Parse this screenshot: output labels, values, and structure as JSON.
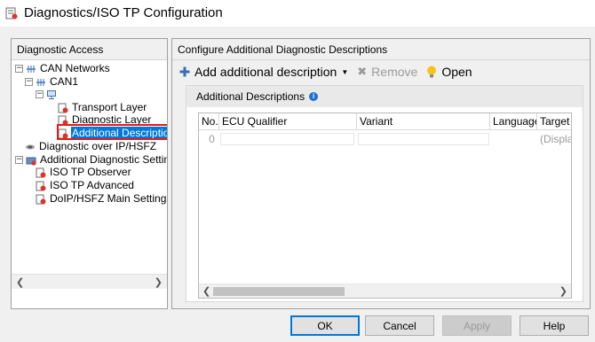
{
  "window": {
    "title": "Diagnostics/ISO TP Configuration"
  },
  "left_panel": {
    "header": "Diagnostic Access",
    "tree": [
      {
        "label": "CAN Networks",
        "icon": "network-icon",
        "expanded": true
      },
      {
        "label": "CAN1",
        "icon": "network-icon",
        "expanded": true
      },
      {
        "label": "",
        "icon": "computer-node-icon",
        "expanded": true
      },
      {
        "label": "Transport Layer",
        "icon": "settings-doc-icon"
      },
      {
        "label": "Diagnostic Layer",
        "icon": "settings-doc-icon"
      },
      {
        "label": "Additional Descriptions",
        "icon": "settings-doc-icon",
        "selected": true
      },
      {
        "label": "Diagnostic over IP/HSFZ",
        "icon": "ethernet-icon"
      },
      {
        "label": "Additional Diagnostic Settings",
        "icon": "settings-folder-icon",
        "expanded": true
      },
      {
        "label": "ISO TP Observer",
        "icon": "settings-doc-icon"
      },
      {
        "label": "ISO TP Advanced",
        "icon": "settings-doc-icon"
      },
      {
        "label": "DoIP/HSFZ Main Settings",
        "icon": "settings-doc-icon"
      }
    ]
  },
  "right_panel": {
    "header": "Configure Additional Diagnostic Descriptions",
    "toolbar": {
      "add_label": "Add additional description",
      "remove_label": "Remove",
      "open_label": "Open"
    },
    "section_title": "Additional Descriptions",
    "table": {
      "columns": [
        "No.",
        "ECU Qualifier",
        "Variant",
        "Language",
        "Target"
      ],
      "rows": [
        {
          "no": "0",
          "ecu_qualifier": "",
          "variant": "",
          "language": "",
          "target": "(Displa"
        }
      ]
    }
  },
  "buttons": {
    "ok": "OK",
    "cancel": "Cancel",
    "apply": "Apply",
    "help": "Help"
  },
  "colors": {
    "selection": "#0078d7",
    "highlight_box": "#e21a1a",
    "accent_blue": "#1f6fd1"
  }
}
